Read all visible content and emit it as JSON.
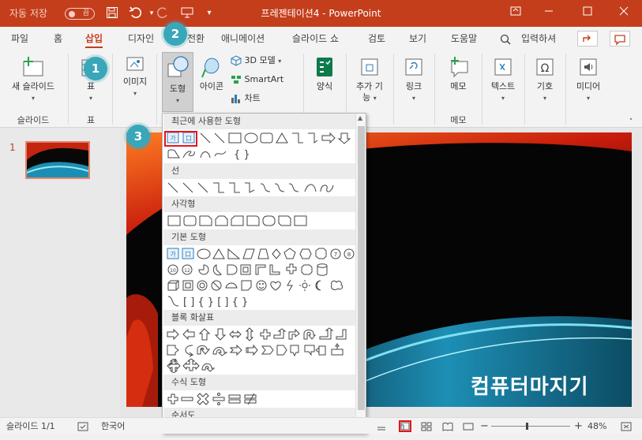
{
  "titlebar": {
    "autosave_label": "자동 저장",
    "autosave_state": "끔",
    "title": "프레젠테이션4  -  PowerPoint",
    "window_controls": [
      "restore-ribbon-icon",
      "minimize-icon",
      "maximize-icon",
      "close-icon"
    ]
  },
  "tabs": [
    "파일",
    "홈",
    "삽입",
    "디자인",
    "전환",
    "애니메이션",
    "슬라이드 쇼",
    "검토",
    "보기",
    "도움말"
  ],
  "active_tab": "삽입",
  "tellme": "입력하셔",
  "ribbon": {
    "new_slide": "새 슬라이드",
    "slides_group": "슬라이드",
    "table": "표",
    "table_group": "표",
    "image": "이미지",
    "shapes": "도형",
    "icons": "아이콘",
    "model3d": "3D 모델",
    "smartart": "SmartArt",
    "chart": "차트",
    "forms": "양식",
    "addins_1": "추가 기",
    "addins_2": "능",
    "link": "링크",
    "comment": "메모",
    "comment_group": "메모",
    "text": "텍스트",
    "symbols": "기호",
    "media": "미디어"
  },
  "dropdown": {
    "recent": "최근에 사용한 도형",
    "lines": "선",
    "rectangles": "사각형",
    "basic": "기본 도형",
    "block_arrows": "블록 화살표",
    "equation": "수식 도형",
    "flowchart": "순서도"
  },
  "thumbnail": {
    "number": "1"
  },
  "status": {
    "slide": "슬라이드 1/1",
    "lang": "한국어",
    "zoom": "48%"
  },
  "badges": {
    "one": "1",
    "two": "2",
    "three": "3"
  },
  "watermark": "컴퓨터마지기",
  "colors": {
    "accent": "#c43e1c",
    "badge": "#3aa6b9",
    "highlight": "#e8131b"
  }
}
